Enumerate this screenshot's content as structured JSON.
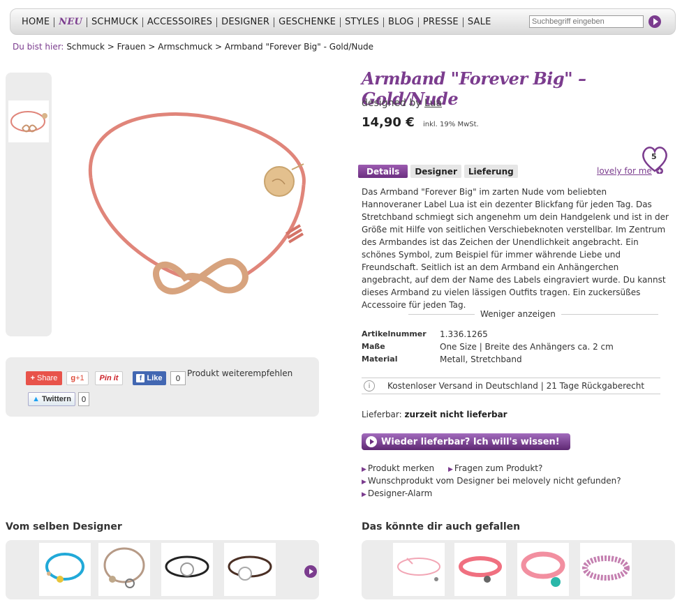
{
  "nav": {
    "items": [
      "HOME",
      "NEU",
      "SCHMUCK",
      "ACCESSOIRES",
      "DESIGNER",
      "GESCHENKE",
      "STYLES",
      "BLOG",
      "PRESSE",
      "SALE"
    ],
    "search_placeholder": "Suchbegriff eingeben"
  },
  "breadcrumb": {
    "label": "Du bist hier:",
    "path": "Schmuck > Frauen > Armschmuck > Armband \"Forever Big\" - Gold/Nude"
  },
  "share": {
    "share_label": "Share",
    "gplus_label": "+1",
    "pinit_label": "Pin it",
    "like_label": "Like",
    "like_count": "0",
    "twitter_label": "Twittern",
    "twitter_count": "0",
    "recommend_text": "Produkt weiterempfehlen"
  },
  "product": {
    "title": "Armband \"Forever Big\" – Gold/Nude",
    "designed_by_prefix": "designed by",
    "designer": "Lua",
    "price": "14,90 €",
    "vat": "inkl. 19% MwSt.",
    "tabs": [
      "Details",
      "Designer",
      "Lieferung"
    ],
    "lovely_label": "lovely for me",
    "lovely_count": "5",
    "description": "Das Armband \"Forever Big\" im zarten Nude vom beliebten Hannoveraner Label Lua ist ein dezenter Blickfang für jeden Tag. Das Stretchband schmiegt sich angenehm um dein Handgelenk und ist in der Größe mit Hilfe von seitlichen Verschiebeknoten verstellbar. Im Zentrum des Armbandes ist das Zeichen der Unendlichkeit angebracht. Ein schönes Symbol, zum Beispiel für immer währende Liebe und Freundschaft. Seitlich ist an dem Armband ein Anhängerchen angebracht, auf dem der Name des Labels eingraviert wurde. Du kannst dieses Armband zu vielen lässigen Outfits tragen. Ein zuckersüßes Accessoire für jeden Tag.",
    "less_label": "Weniger anzeigen",
    "specs": [
      {
        "key": "Artikelnummer",
        "value": "1.336.1265"
      },
      {
        "key": "Maße",
        "value": "One Size | Breite des Anhängers ca. 2 cm"
      },
      {
        "key": "Material",
        "value": "Metall, Stretchband"
      }
    ],
    "shipping_info": "Kostenloser Versand in Deutschland | 21 Tage Rückgaberecht",
    "availability_label": "Lieferbar:",
    "availability_value": "zurzeit nicht lieferbar",
    "notify_button": "Wieder lieferbar? Ich will's wissen!",
    "links": {
      "remember": "Produkt merken",
      "question": "Fragen zum Produkt?",
      "wish": "Wunschprodukt vom Designer bei melovely nicht gefunden?",
      "alarm": "Designer-Alarm"
    }
  },
  "sections": {
    "same_designer": "Vom selben Designer",
    "might_like": "Das könnte dir auch gefallen"
  },
  "colors": {
    "accent": "#7b3c8e",
    "cord": "#e0857a",
    "gold": "#d9b48a"
  }
}
